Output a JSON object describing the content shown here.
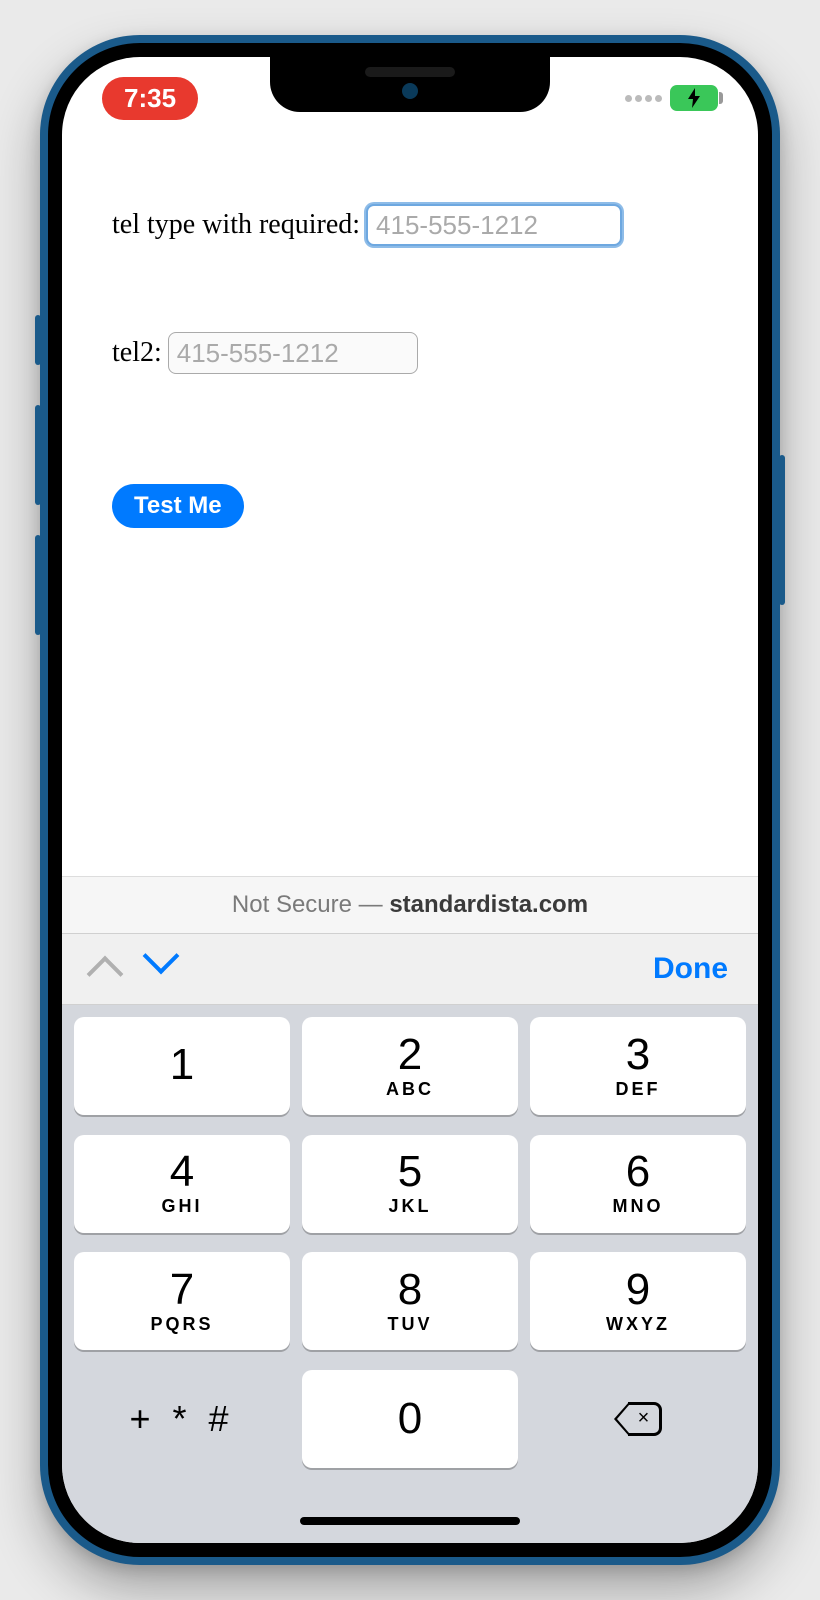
{
  "status": {
    "time": "7:35"
  },
  "form": {
    "label1": "tel type with required:",
    "placeholder1": "415-555-1212",
    "label2": "tel2:",
    "placeholder2": "415-555-1212",
    "button": "Test Me"
  },
  "urlbar": {
    "prefix": "Not Secure — ",
    "domain": "standardista.com"
  },
  "accessory": {
    "done": "Done"
  },
  "keypad": {
    "keys": [
      {
        "d": "1",
        "l": ""
      },
      {
        "d": "2",
        "l": "ABC"
      },
      {
        "d": "3",
        "l": "DEF"
      },
      {
        "d": "4",
        "l": "GHI"
      },
      {
        "d": "5",
        "l": "JKL"
      },
      {
        "d": "6",
        "l": "MNO"
      },
      {
        "d": "7",
        "l": "PQRS"
      },
      {
        "d": "8",
        "l": "TUV"
      },
      {
        "d": "9",
        "l": "WXYZ"
      }
    ],
    "symbols": "+ * #",
    "zero": "0"
  }
}
